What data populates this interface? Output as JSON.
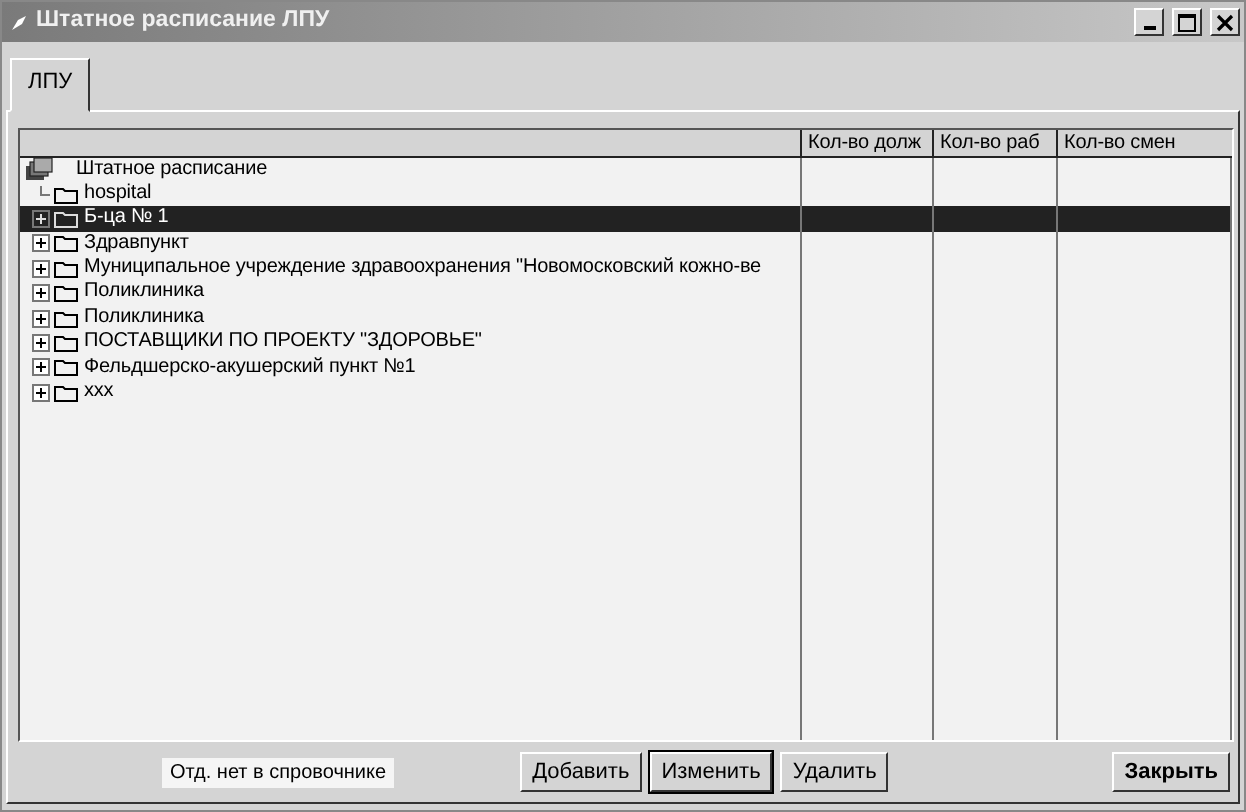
{
  "window": {
    "title": "Штатное расписание ЛПУ"
  },
  "tabs": [
    {
      "label": "ЛПУ",
      "selected": true
    }
  ],
  "table": {
    "columns": [
      "Кол-во долж",
      "Кол-во раб",
      "Кол-во смен"
    ],
    "tree": {
      "label": "Штатное расписание",
      "children": [
        {
          "label": "hospital",
          "expandable": false,
          "selected": false
        },
        {
          "label": "Б-ца № 1",
          "expandable": true,
          "selected": true
        },
        {
          "label": "Здравпункт",
          "expandable": true,
          "selected": false
        },
        {
          "label": "Муниципальное учреждение здравоохранения \"Новомосковский кожно-ве",
          "expandable": true,
          "selected": false
        },
        {
          "label": "Поликлиника",
          "expandable": true,
          "selected": false
        },
        {
          "label": "Поликлиника",
          "expandable": true,
          "selected": false
        },
        {
          "label": "ПОСТАВЩИКИ ПО ПРОЕКТУ \"ЗДОРОВЬЕ\"",
          "expandable": true,
          "selected": false
        },
        {
          "label": "Фельдшерско-акушерский пункт  №1",
          "expandable": true,
          "selected": false
        },
        {
          "label": "xxx",
          "expandable": true,
          "selected": false
        }
      ]
    }
  },
  "status": "Отд. нет в спровочнике",
  "buttons": [
    {
      "label": "Добавить",
      "default": false
    },
    {
      "label": "Изменить",
      "default": true
    },
    {
      "label": "Удалить",
      "default": false
    },
    {
      "label": "Закрыть",
      "default": false,
      "kind": "close"
    }
  ]
}
